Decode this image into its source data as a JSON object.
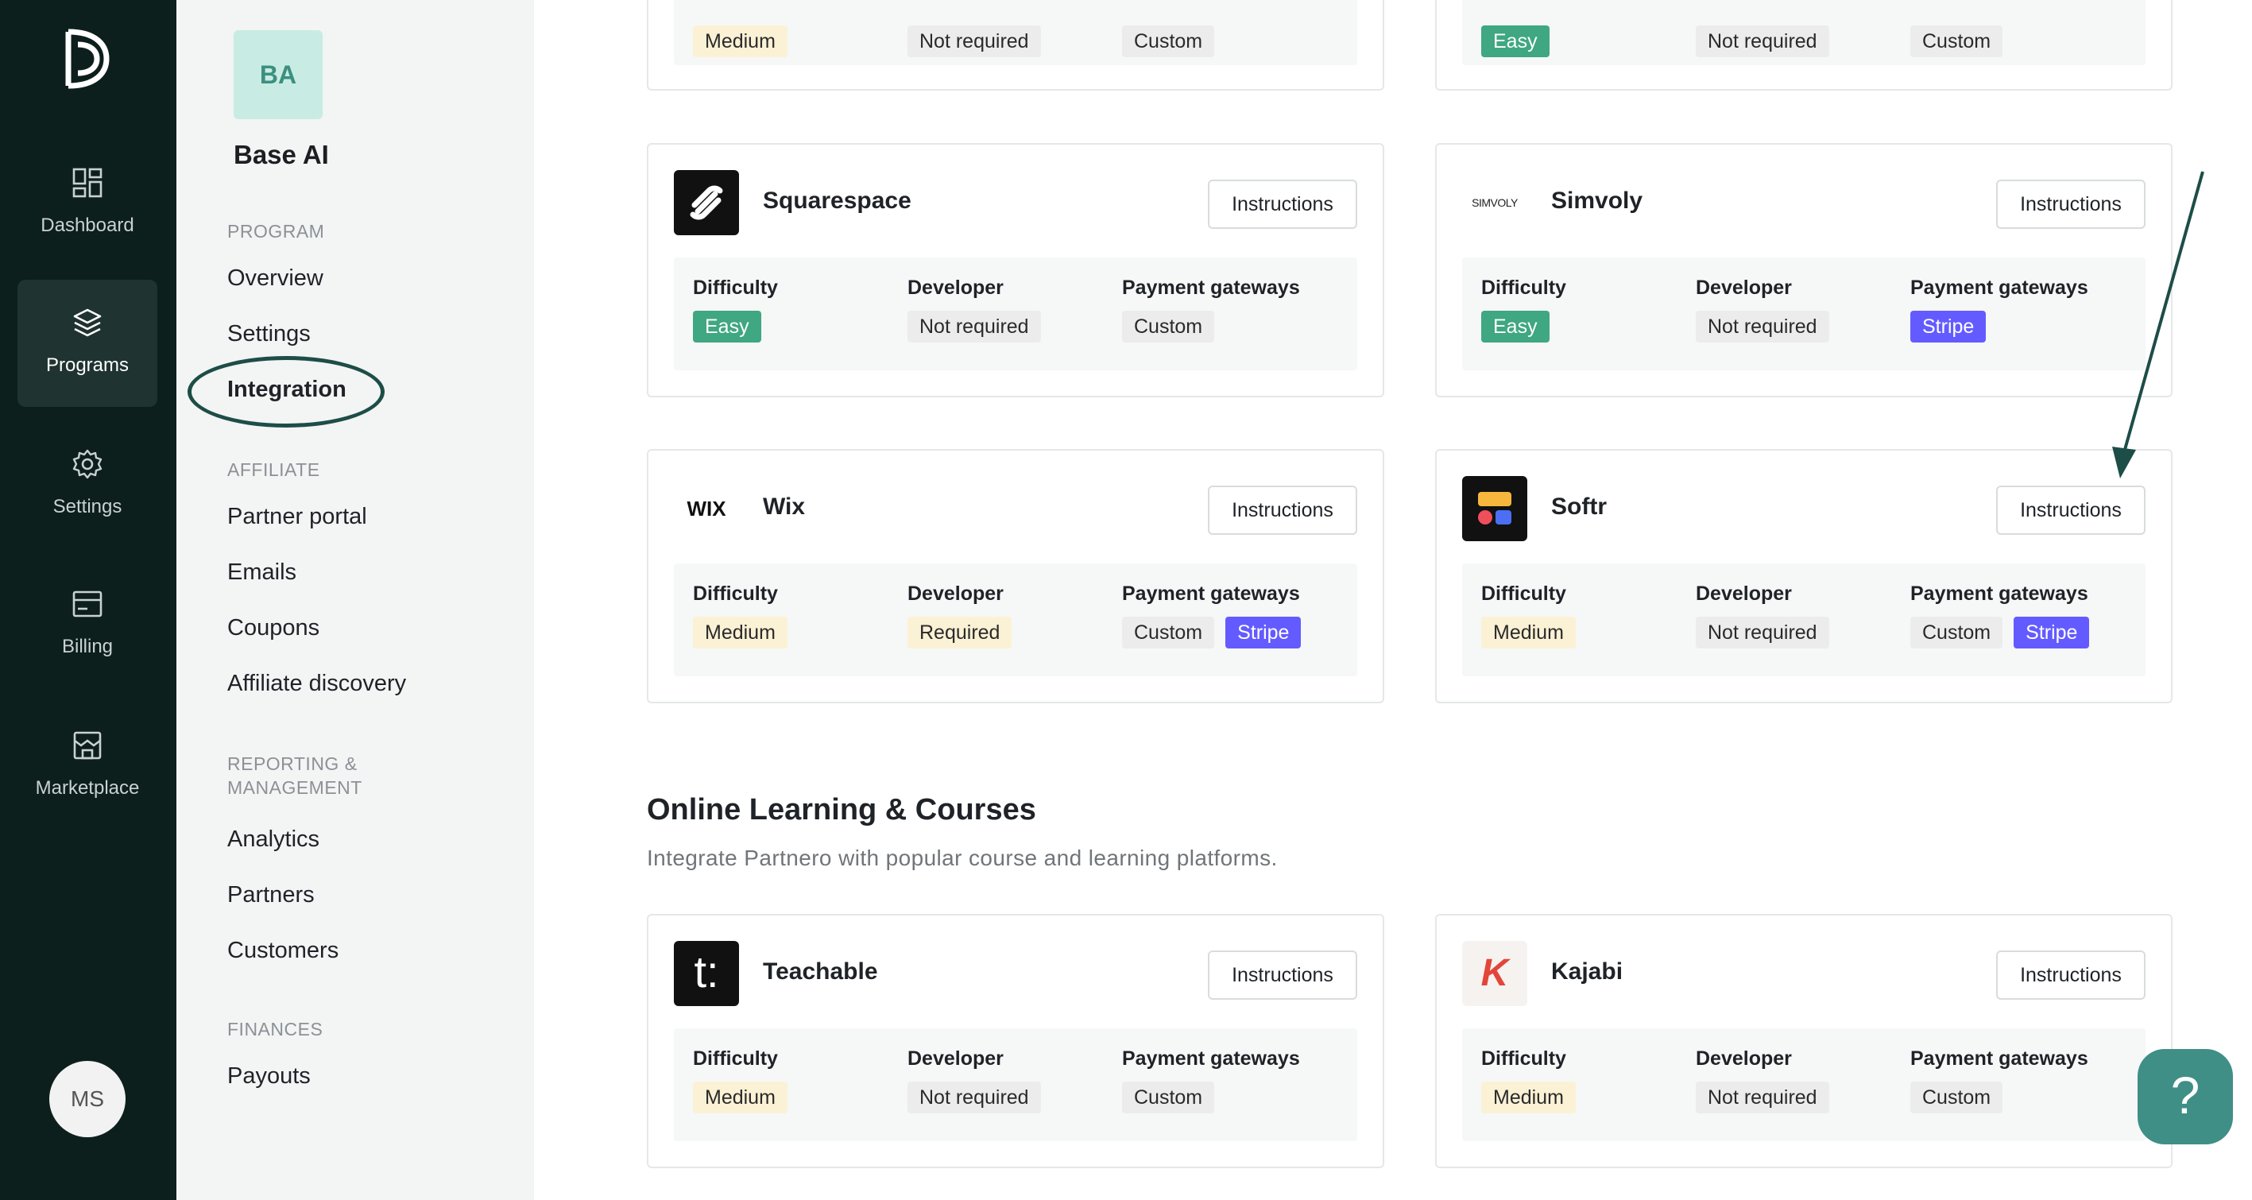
{
  "rail": {
    "items": [
      {
        "label": "Dashboard",
        "icon": "dashboard-icon"
      },
      {
        "label": "Programs",
        "icon": "layers-icon",
        "active": true
      },
      {
        "label": "Settings",
        "icon": "gear-icon"
      },
      {
        "label": "Billing",
        "icon": "billing-icon"
      },
      {
        "label": "Marketplace",
        "icon": "store-icon"
      }
    ],
    "user_initials": "MS"
  },
  "sidebar": {
    "program_initials": "BA",
    "program_name": "Base AI",
    "sections": [
      {
        "title": "PROGRAM",
        "links": [
          "Overview",
          "Settings",
          "Integration"
        ]
      },
      {
        "title": "AFFILIATE",
        "links": [
          "Partner portal",
          "Emails",
          "Coupons",
          "Affiliate discovery"
        ]
      },
      {
        "title": "REPORTING & MANAGEMENT",
        "links": [
          "Analytics",
          "Partners",
          "Customers"
        ]
      },
      {
        "title": "FINANCES",
        "links": [
          "Payouts"
        ]
      }
    ],
    "current": "Integration"
  },
  "labels": {
    "difficulty": "Difficulty",
    "developer": "Developer",
    "payment": "Payment gateways",
    "instructions": "Instructions"
  },
  "cards": [
    {
      "name": "",
      "difficulty": "Medium",
      "developer": "Not required",
      "gateways": [
        "Custom"
      ]
    },
    {
      "name": "",
      "difficulty": "Easy",
      "developer": "Not required",
      "gateways": [
        "Custom"
      ]
    },
    {
      "name": "Squarespace",
      "logo": "squarespace-logo",
      "difficulty": "Easy",
      "developer": "Not required",
      "gateways": [
        "Custom"
      ]
    },
    {
      "name": "Simvoly",
      "logo": "simvoly-logo",
      "logo_text": "SIMVOLY",
      "difficulty": "Easy",
      "developer": "Not required",
      "gateways": [
        "Stripe"
      ]
    },
    {
      "name": "Wix",
      "logo": "wix-logo",
      "logo_text": "WIX",
      "difficulty": "Medium",
      "developer": "Required",
      "gateways": [
        "Custom",
        "Stripe"
      ]
    },
    {
      "name": "Softr",
      "logo": "softr-logo",
      "difficulty": "Medium",
      "developer": "Not required",
      "gateways": [
        "Custom",
        "Stripe"
      ]
    },
    {
      "name": "Teachable",
      "logo": "teachable-logo",
      "logo_text": "t:",
      "difficulty": "Medium",
      "developer": "Not required",
      "gateways": [
        "Custom"
      ]
    },
    {
      "name": "Kajabi",
      "logo": "kajabi-logo",
      "logo_text": "K",
      "difficulty": "Medium",
      "developer": "Not required",
      "gateways": [
        "Custom"
      ]
    }
  ],
  "section": {
    "title": "Online Learning & Courses",
    "subtitle": "Integrate Partnero with popular course and learning platforms."
  },
  "help": {
    "label": "?"
  },
  "colors": {
    "rail_bg": "#0d1f1d",
    "accent": "#3f8f86",
    "easy": "#3fa782",
    "stripe": "#635bff",
    "medium": "#fbf1d5"
  }
}
